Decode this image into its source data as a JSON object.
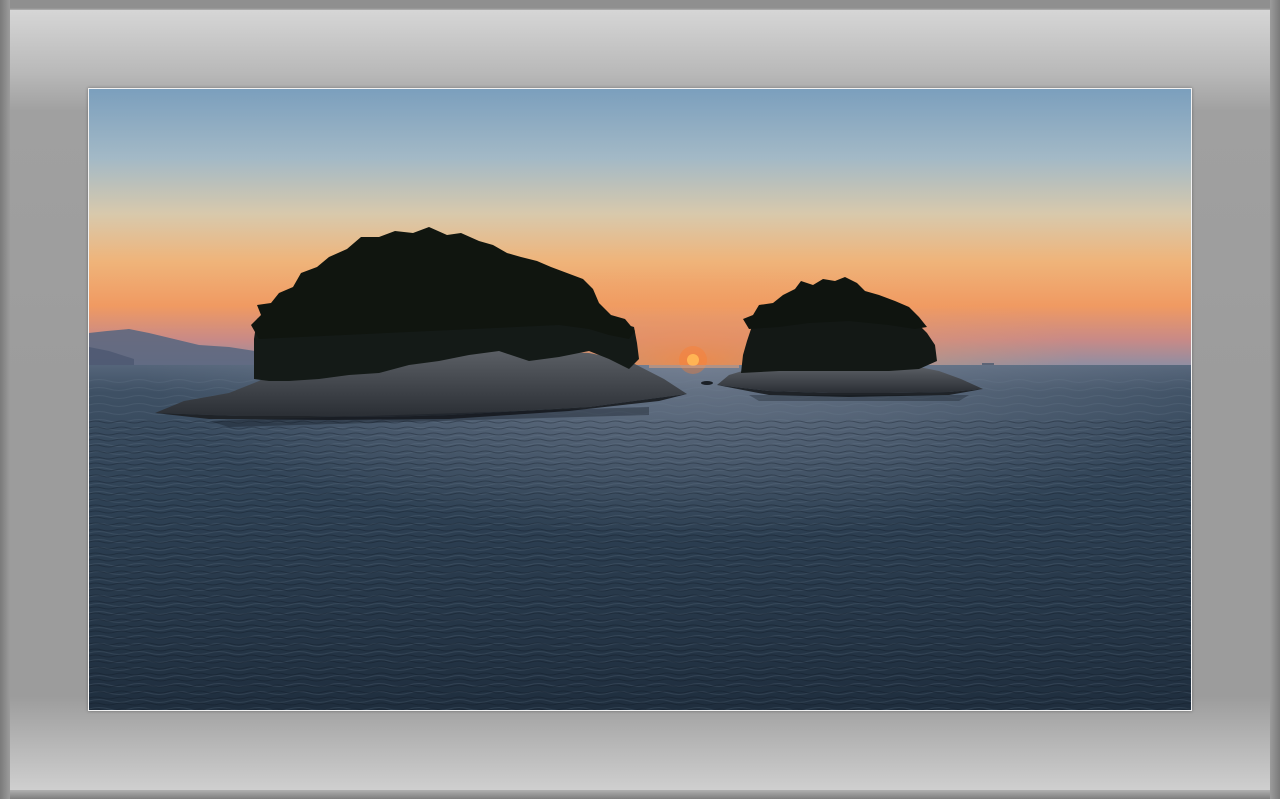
{
  "scene": {
    "subject": "sunset-over-sea-with-two-islands",
    "colors": {
      "frame": "#9c9c9c",
      "sky_top": "#7fa2bf",
      "sky_horizon": "#f0a35e",
      "sun": "#ff5a1a",
      "sea": "#2a3c50",
      "island": "#141a18"
    }
  }
}
